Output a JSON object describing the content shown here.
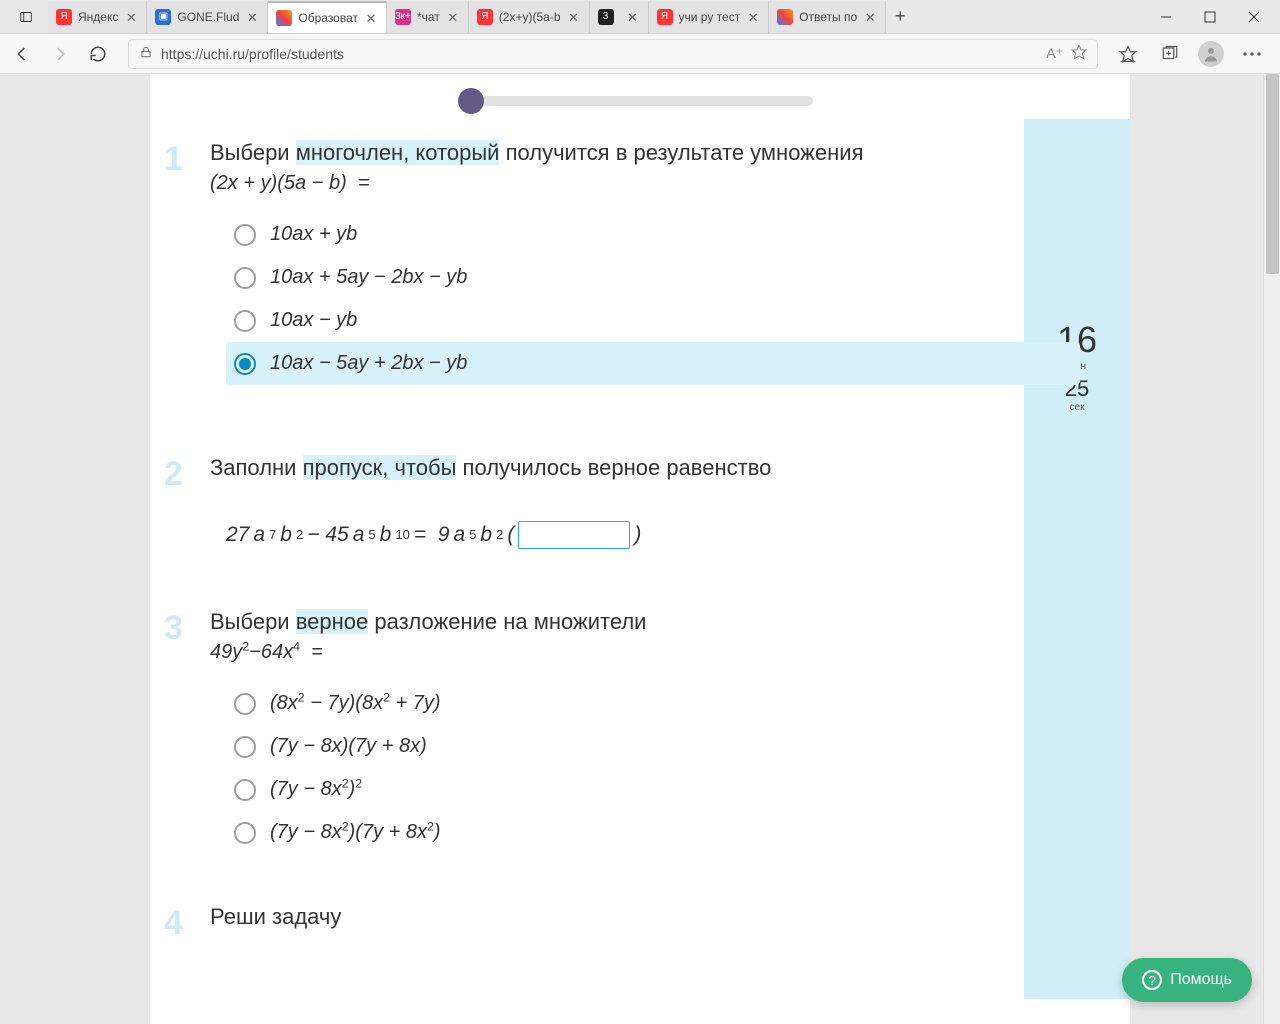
{
  "browser": {
    "tabs": [
      {
        "label": "Яндекс"
      },
      {
        "label": "GONE.Flud"
      },
      {
        "label": "Образоват"
      },
      {
        "label": "*чат"
      },
      {
        "label": "(2x+y)(5a-b"
      },
      {
        "label": ""
      },
      {
        "label": "учи ру тест"
      },
      {
        "label": "Ответы по"
      }
    ],
    "url": "https://uchi.ru/profile/students"
  },
  "timer": {
    "min": "16",
    "min_lbl": "мин",
    "sec": "25",
    "sec_lbl": "сек"
  },
  "q1": {
    "num": "1",
    "title_pre": "Выбери ",
    "title_hl": "многочлен, который",
    "title_post": " получится в результате умножения",
    "expr": "(2x + y)(5a − b)  =",
    "opts": [
      "10ax + yb",
      "10ax + 5ay − 2bx − yb",
      "10ax − yb",
      "10ax − 5ay + 2bx − yb"
    ]
  },
  "q2": {
    "num": "2",
    "title_pre": "Заполни ",
    "title_hl": "пропуск, чтобы",
    "title_post": " получилось верное равенство"
  },
  "q3": {
    "num": "3",
    "title_pre": "Выбери ",
    "title_hl": "верное",
    "title_post": " разложение на множители"
  },
  "q4": {
    "num": "4",
    "title": "Реши задачу"
  },
  "help": "Помощь"
}
